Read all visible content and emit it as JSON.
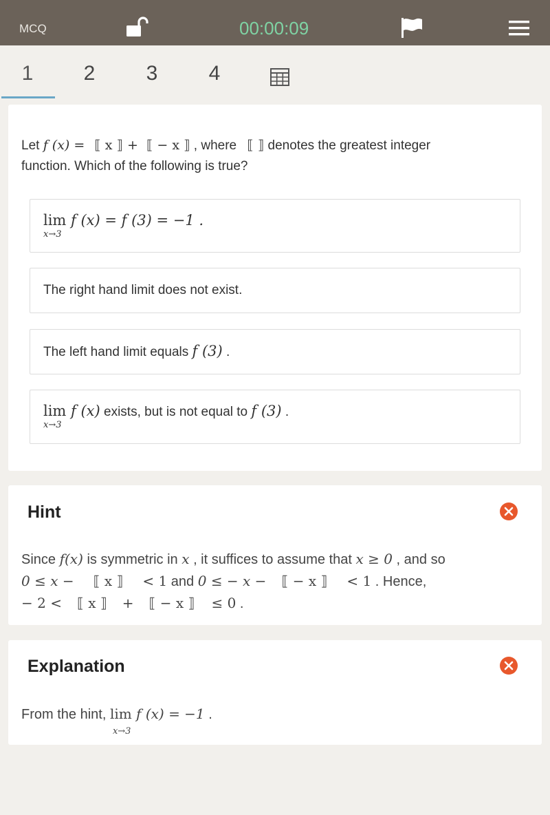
{
  "topbar": {
    "mode_label": "MCQ",
    "timer": "00:00:09",
    "lock_icon": "unlock-icon",
    "flag_icon": "flag-icon",
    "menu_icon": "hamburger-menu-icon"
  },
  "question_tabs": [
    "1",
    "2",
    "3",
    "4"
  ],
  "active_tab": "1",
  "question": {
    "prefix": "Let ",
    "fx": "f (x) = ",
    "floor_x": "⟦ x ⟧",
    "plus": " + ",
    "floor_negx": "⟦ − x ⟧",
    "where": " , where ",
    "floor_empty": "⟦ ⟧",
    "suffix": " denotes the greatest integer",
    "line2": "function. Which of the following is true?"
  },
  "options": [
    {
      "lim": "lim",
      "sub": "x→3",
      "text": " f (x) = f (3) = −1 .",
      "mode": "math"
    },
    {
      "text": "The right hand limit does not exist.",
      "mode": "plain"
    },
    {
      "pre": "The left hand limit equals ",
      "math": "f (3)",
      "post": " .",
      "mode": "mixed"
    },
    {
      "lim": "lim",
      "sub": "x→3",
      "math1": " f (x)",
      "mid": " exists, but is not equal to ",
      "math2": "f (3)",
      "post": " .",
      "mode": "limmixed"
    }
  ],
  "hint": {
    "title": "Hint",
    "line1_pre": "Since ",
    "line1_m1": "f(x)",
    "line1_mid1": " is symmetric in ",
    "line1_m2": "x",
    "line1_mid2": " , it suffices to assume that ",
    "line1_m3": "x ≥ 0",
    "line1_post": " , and so",
    "line2_m1": "0 ≤ x −",
    "line2_m2": "⟦ x ⟧",
    "line2_m3": "< 1",
    "line2_mid": " and ",
    "line2_m4": "0 ≤  − x −",
    "line2_m5": "⟦ − x ⟧",
    "line2_m6": "< 1",
    "line2_post": " . Hence,",
    "line3_m1": "− 2 <",
    "line3_m2": "⟦ x ⟧",
    "line3_m3": "+",
    "line3_m4": "⟦ − x ⟧",
    "line3_m5": "≤ 0",
    "line3_post": " ."
  },
  "explanation": {
    "title": "Explanation",
    "pre": "From the hint, ",
    "lim": "lim",
    "sub": "x→3",
    "math": " f (x) = −1",
    "post": " ."
  },
  "colors": {
    "topbar": "#6b6259",
    "timer": "#7fd3a4",
    "close": "#e8582c",
    "tab_underline": "#6aa7c7",
    "background": "#f2f0ec"
  }
}
